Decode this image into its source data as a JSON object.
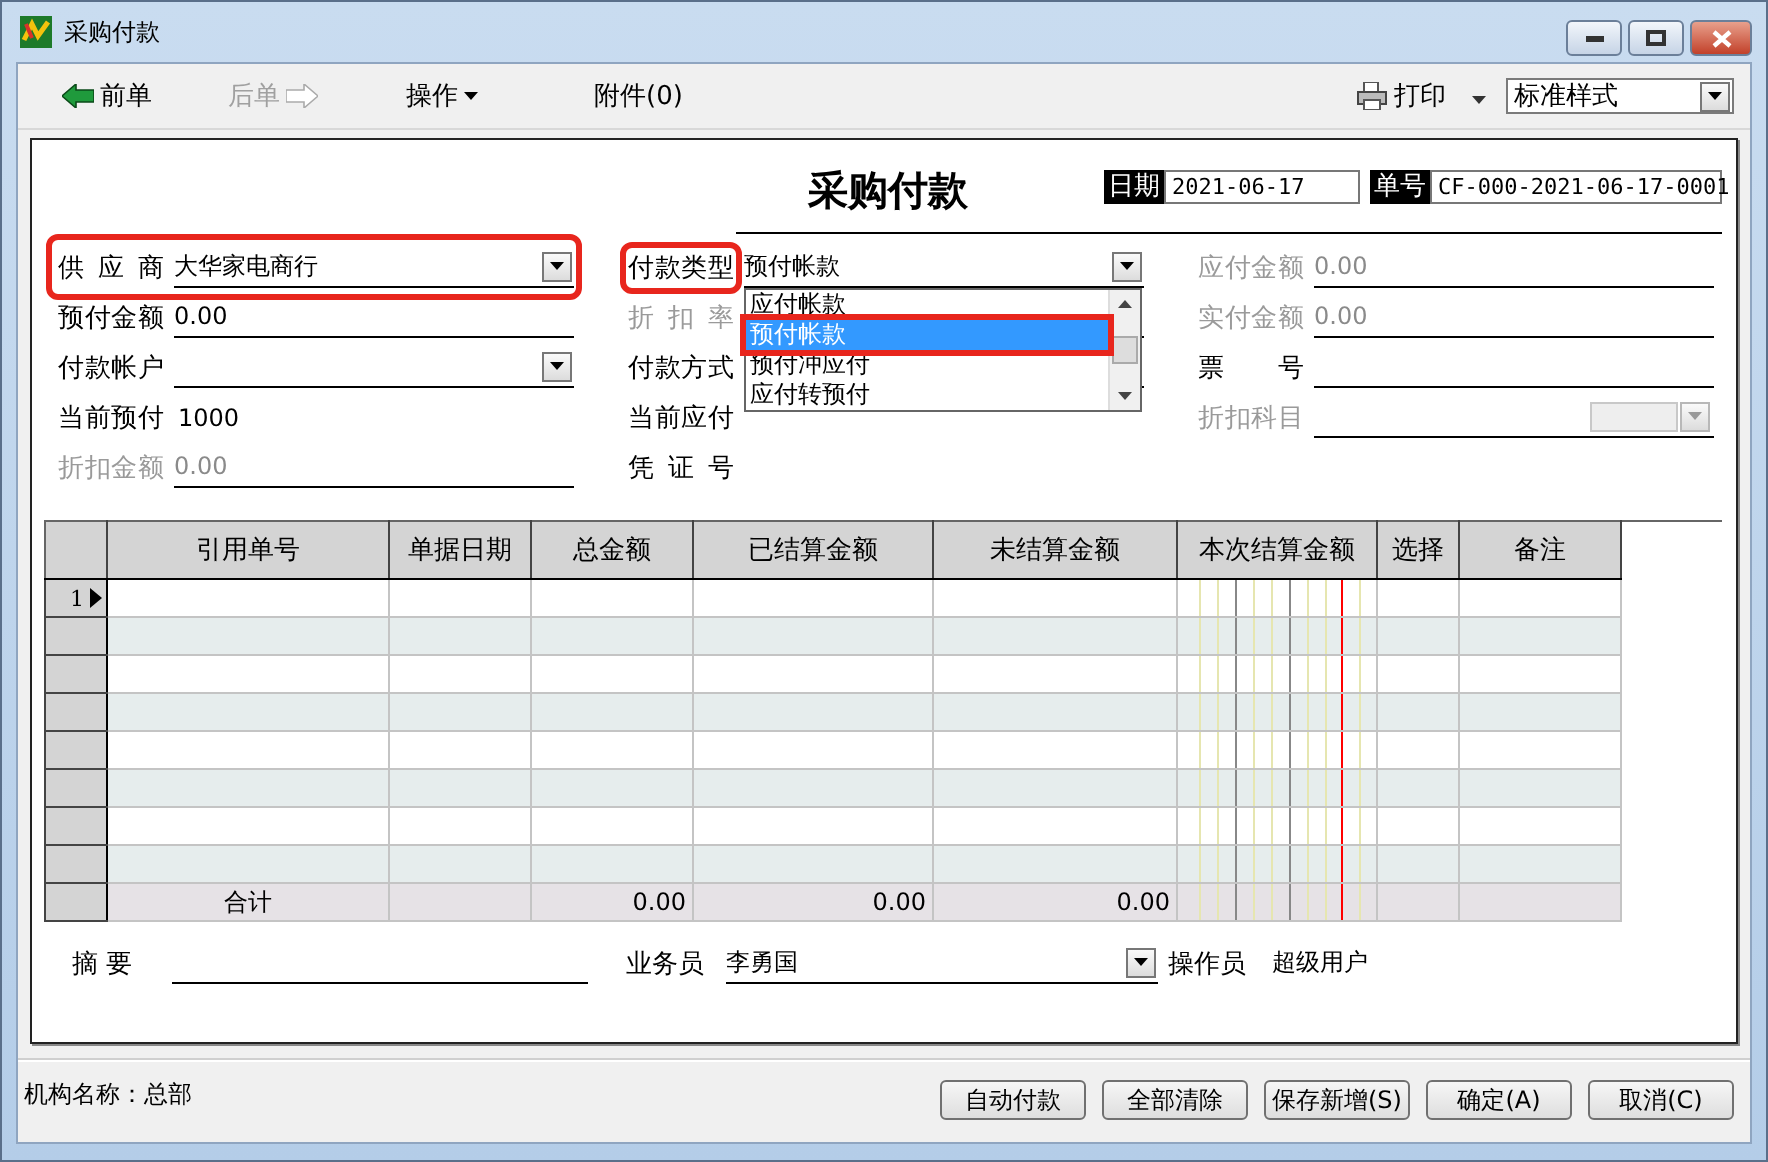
{
  "window": {
    "title": "采购付款"
  },
  "toolbar": {
    "items": [
      {
        "label": "前单",
        "kind": "back",
        "disabled": false
      },
      {
        "label": "后单",
        "kind": "forward",
        "disabled": true
      },
      {
        "label": "操作",
        "kind": "menu",
        "disabled": false
      },
      {
        "label": "附件(0)",
        "kind": "plain",
        "disabled": false
      }
    ],
    "print": "打印",
    "style_select": {
      "value": "标准样式"
    }
  },
  "form": {
    "title": "采购付款",
    "date": {
      "label": "日期",
      "value": "2021-06-17"
    },
    "number": {
      "label": "单号",
      "value": "CF-000-2021-06-17-0001"
    },
    "columns": [
      [
        {
          "label": "供 应 商",
          "kind": "combo",
          "value": "大华家电商行",
          "disabled": false,
          "highlighted": true,
          "label_highlighted": false
        },
        {
          "label": "预付金额",
          "kind": "text",
          "value": "0.00",
          "disabled": false
        },
        {
          "label": "付款帐户",
          "kind": "combo",
          "disabled": false
        },
        {
          "label": "当前预付",
          "kind": "plain",
          "value": "1000",
          "disabled": false
        },
        {
          "label": "折扣金额",
          "kind": "text",
          "value": "0.00",
          "disabled": true
        }
      ],
      [
        {
          "label": "付款类型",
          "kind": "combo",
          "value": "预付帐款",
          "disabled": false,
          "highlighted": false,
          "label_highlighted": true,
          "dropdown": {
            "options": [
              {
                "label": "应付帐款",
                "selected": false,
                "highlighted": false
              },
              {
                "label": "预付帐款",
                "selected": true,
                "highlighted": true
              },
              {
                "label": "预付冲应付",
                "selected": false,
                "highlighted": false
              },
              {
                "label": "应付转预付",
                "selected": false,
                "highlighted": false
              }
            ]
          }
        },
        {
          "label": "折 扣 率",
          "kind": "text",
          "disabled": true
        },
        {
          "label": "付款方式",
          "kind": "text",
          "disabled": false
        },
        {
          "label": "当前应付",
          "kind": "plain",
          "disabled": false
        },
        {
          "label": "凭 证 号",
          "kind": "plain",
          "disabled": false
        }
      ],
      [
        {
          "label": "应付金额",
          "kind": "text",
          "value": "0.00",
          "disabled": true
        },
        {
          "label": "实付金额",
          "kind": "text",
          "value": "0.00",
          "disabled": true
        },
        {
          "label": "票 号",
          "kind": "text",
          "disabled": false
        },
        {
          "label": "折扣科目",
          "kind": "combo",
          "disabled": true
        }
      ]
    ]
  },
  "table": {
    "columns": [
      {
        "title": "引用单号",
        "kind": "text",
        "total": "合计"
      },
      {
        "title": "单据日期",
        "kind": "text"
      },
      {
        "title": "总金额",
        "kind": "amount",
        "total": "0.00"
      },
      {
        "title": "已结算金额",
        "kind": "amount",
        "total": "0.00"
      },
      {
        "title": "未结算金额",
        "kind": "amount",
        "total": "0.00"
      },
      {
        "title": "本次结算金额",
        "kind": "digits"
      },
      {
        "title": "选择",
        "kind": "text"
      },
      {
        "title": "备注",
        "kind": "text"
      }
    ],
    "rows": [
      {
        "number": "1",
        "current": true
      },
      {
        "current": false
      },
      {
        "current": false
      },
      {
        "current": false
      },
      {
        "current": false
      },
      {
        "current": false
      },
      {
        "current": false
      },
      {
        "current": false
      }
    ]
  },
  "bottom": {
    "summary": {
      "label": "摘 要"
    },
    "salesperson": {
      "label": "业务员",
      "value": "李勇国"
    },
    "operator": {
      "label": "操作员",
      "value": "超级用户"
    }
  },
  "status_bar": {
    "org": "机构名称：总部",
    "buttons": [
      "自动付款",
      "全部清除",
      "保存新增(S)",
      "确定(A)",
      "取消(C)"
    ]
  }
}
